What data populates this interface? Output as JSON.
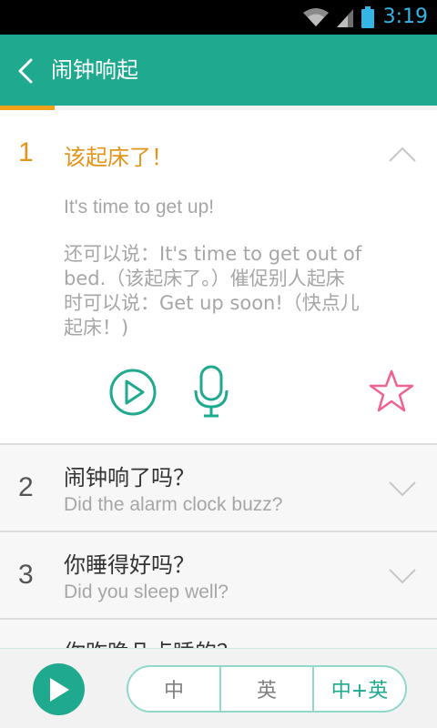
{
  "status_bar": {
    "time": "3:19",
    "icons": [
      "wifi-icon",
      "signal-icon",
      "battery-icon"
    ]
  },
  "app_bar": {
    "title": "闹钟响起",
    "back_icon": "chevron-left-icon"
  },
  "progress": {
    "fraction": 0.125,
    "color": "#f0a11a"
  },
  "expanded_item": {
    "number": "1",
    "chinese": "该起床了！",
    "english": "It's time to get up!",
    "note_lines": [
      "还可以说：It's time to get out of",
      "bed.（该起床了。）催促别人起床",
      "时可以说：Get up soon!（快点儿",
      "起床！)"
    ],
    "actions": [
      "play-circle-icon",
      "microphone-icon",
      "star-outline-icon"
    ]
  },
  "items": [
    {
      "number": "2",
      "chinese": "闹钟响了吗？",
      "english": "Did the alarm clock buzz?"
    },
    {
      "number": "3",
      "chinese": "你睡得好吗？",
      "english": "Did you sleep well?"
    },
    {
      "number": "",
      "chinese": "你昨晚几点睡的？",
      "english": ""
    }
  ],
  "bottom_bar": {
    "play_icon": "play-icon",
    "modes": [
      "中",
      "英",
      "中+英"
    ],
    "selected_mode": "中+英"
  },
  "colors": {
    "accent": "#1fa98f",
    "highlight": "#e5941a",
    "star": "#f06292"
  }
}
